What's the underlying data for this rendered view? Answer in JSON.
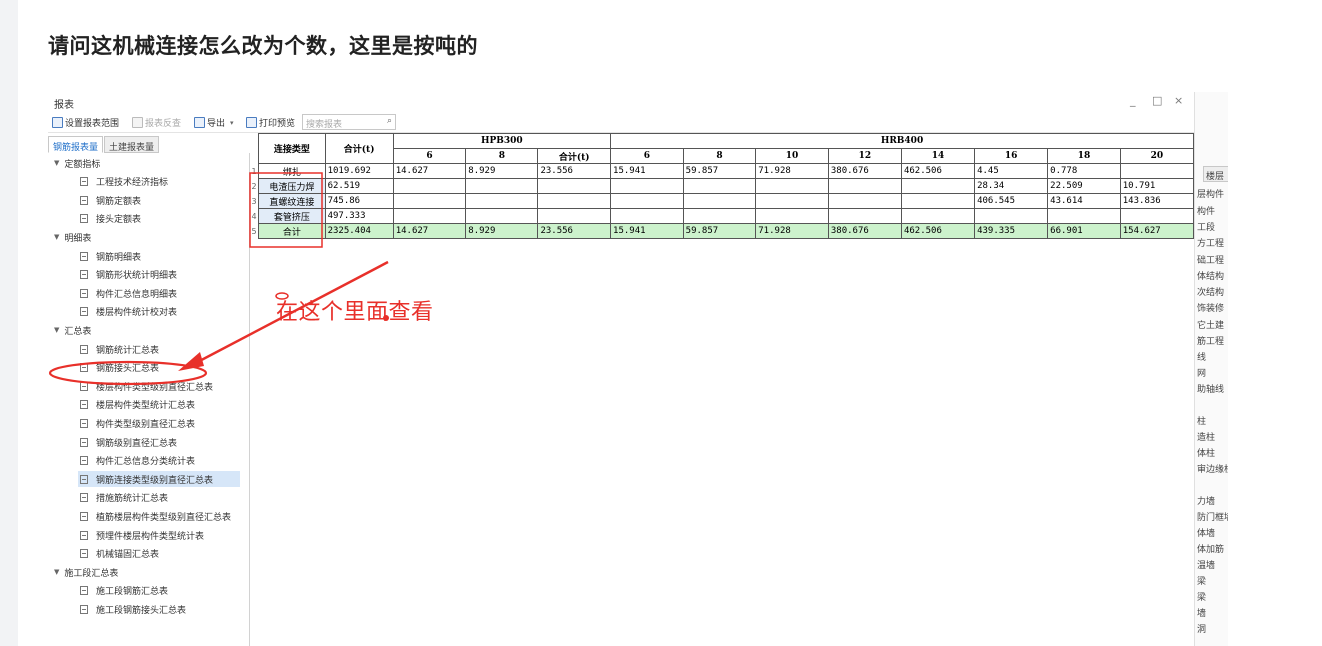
{
  "question": "请问这机械连接怎么改为个数，这里是按吨的",
  "window": {
    "title": "报表",
    "controls": [
      "_",
      "□",
      "×"
    ]
  },
  "toolbar": {
    "items": [
      {
        "label": "设置报表范围",
        "icon": "report-range-icon",
        "disabled": false
      },
      {
        "label": "报表反查",
        "icon": "reverse-lookup-icon",
        "disabled": true
      },
      {
        "label": "导出",
        "icon": "export-icon",
        "disabled": false
      },
      {
        "label": "打印预览",
        "icon": "print-preview-icon",
        "disabled": false
      }
    ],
    "search_placeholder": "搜索报表"
  },
  "tabs": [
    {
      "label": "钢筋报表量",
      "active": true
    },
    {
      "label": "土建报表量",
      "active": false
    }
  ],
  "tree": [
    {
      "type": "group",
      "label": "定额指标"
    },
    {
      "type": "leaf",
      "label": "工程技术经济指标"
    },
    {
      "type": "leaf",
      "label": "钢筋定额表"
    },
    {
      "type": "leaf",
      "label": "接头定额表"
    },
    {
      "type": "group",
      "label": "明细表"
    },
    {
      "type": "leaf",
      "label": "钢筋明细表"
    },
    {
      "type": "leaf",
      "label": "钢筋形状统计明细表"
    },
    {
      "type": "leaf",
      "label": "构件汇总信息明细表"
    },
    {
      "type": "leaf",
      "label": "楼层构件统计校对表"
    },
    {
      "type": "group",
      "label": "汇总表"
    },
    {
      "type": "leaf",
      "label": "钢筋统计汇总表"
    },
    {
      "type": "leaf",
      "label": "钢筋接头汇总表",
      "circled": true
    },
    {
      "type": "leaf",
      "label": "楼层构件类型级别直径汇总表"
    },
    {
      "type": "leaf",
      "label": "楼层构件类型统计汇总表"
    },
    {
      "type": "leaf",
      "label": "构件类型级别直径汇总表"
    },
    {
      "type": "leaf",
      "label": "钢筋级别直径汇总表"
    },
    {
      "type": "leaf",
      "label": "构件汇总信息分类统计表"
    },
    {
      "type": "leaf",
      "label": "钢筋连接类型级别直径汇总表",
      "selected": true
    },
    {
      "type": "leaf",
      "label": "措施筋统计汇总表"
    },
    {
      "type": "leaf",
      "label": "植筋楼层构件类型级别直径汇总表"
    },
    {
      "type": "leaf",
      "label": "预埋件楼层构件类型统计表"
    },
    {
      "type": "leaf",
      "label": "机械锚固汇总表"
    },
    {
      "type": "group",
      "label": "施工段汇总表"
    },
    {
      "type": "leaf",
      "label": "施工段钢筋汇总表"
    },
    {
      "type": "leaf",
      "label": "施工段钢筋接头汇总表"
    }
  ],
  "table": {
    "head_type": "连接类型",
    "head_total": "合计(t)",
    "groups": [
      {
        "label": "HPB300"
      },
      {
        "label": "HRB400"
      }
    ],
    "sub_headers": [
      "6",
      "8",
      "合计(t)",
      "6",
      "8",
      "10",
      "12",
      "14",
      "16",
      "18",
      "20"
    ],
    "rows": [
      {
        "num": "1",
        "label": "绑扎",
        "cells": [
          "1019.692",
          "14.627",
          "8.929",
          "23.556",
          "15.941",
          "59.857",
          "71.928",
          "380.676",
          "462.506",
          "4.45",
          "0.778",
          ""
        ]
      },
      {
        "num": "2",
        "label": "电渣压力焊",
        "cells": [
          "62.519",
          "",
          "",
          "",
          "",
          "",
          "",
          "",
          "",
          "28.34",
          "22.509",
          "10.791"
        ]
      },
      {
        "num": "3",
        "label": "直螺纹连接",
        "cells": [
          "745.86",
          "",
          "",
          "",
          "",
          "",
          "",
          "",
          "",
          "406.545",
          "43.614",
          "143.836"
        ]
      },
      {
        "num": "4",
        "label": "套管挤压",
        "cells": [
          "497.333",
          "",
          "",
          "",
          "",
          "",
          "",
          "",
          "",
          "",
          "",
          ""
        ]
      },
      {
        "num": "5",
        "label": "合计",
        "cells": [
          "2325.404",
          "14.627",
          "8.929",
          "23.556",
          "15.941",
          "59.857",
          "71.928",
          "380.676",
          "462.506",
          "439.335",
          "66.901",
          "154.627"
        ]
      }
    ]
  },
  "right_panel": {
    "tab": "楼层",
    "items": [
      "层构件",
      "构件",
      "工段",
      "方工程",
      "础工程",
      "体结构",
      "次结构",
      "饰装修",
      "它土建",
      "筋工程",
      "线",
      "网",
      "助轴线",
      "柱",
      "造柱",
      "体柱",
      "审边缘柱",
      "力墙",
      "防门框墙",
      "体墙",
      "体加筋",
      "温墙",
      "梁",
      "梁",
      "墙",
      "洞"
    ]
  },
  "annotation": {
    "text": "在这个里面查看",
    "color": "#e8302a"
  }
}
